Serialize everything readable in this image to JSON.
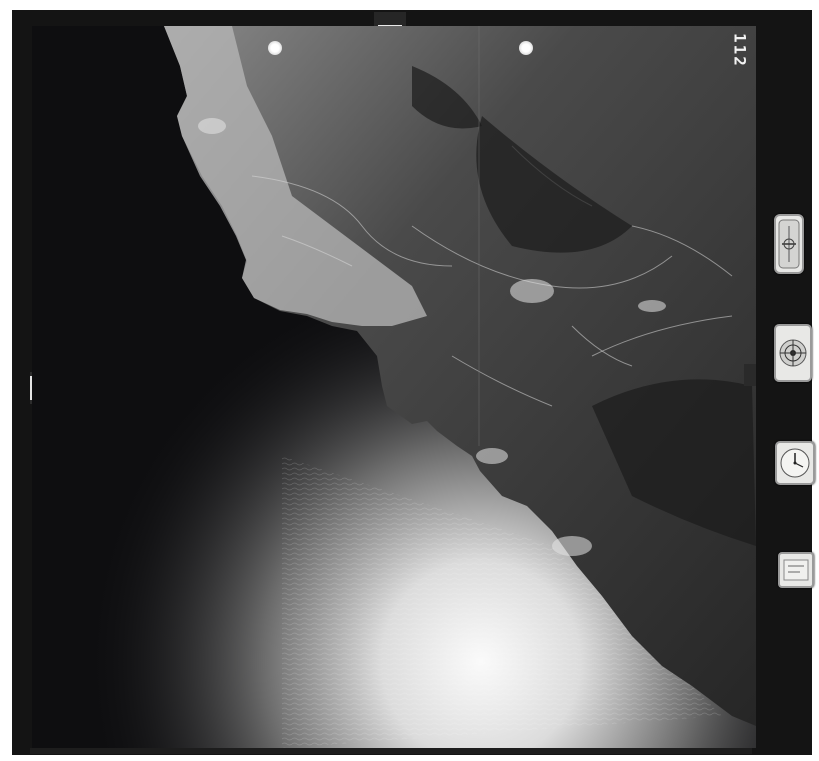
{
  "photo": {
    "frame_number": "112",
    "colors": {
      "film": "#141414",
      "sea": "#0d0d0f",
      "land": "#3a3a3a",
      "coast_highlight": "#bdbdbd",
      "sun_glint": "#f2f2f2"
    }
  },
  "instruments": {
    "altimeter": "altimeter-icon",
    "level": "bubble-level-icon",
    "clock": "clock-icon",
    "counter": "counter-plate-icon"
  }
}
